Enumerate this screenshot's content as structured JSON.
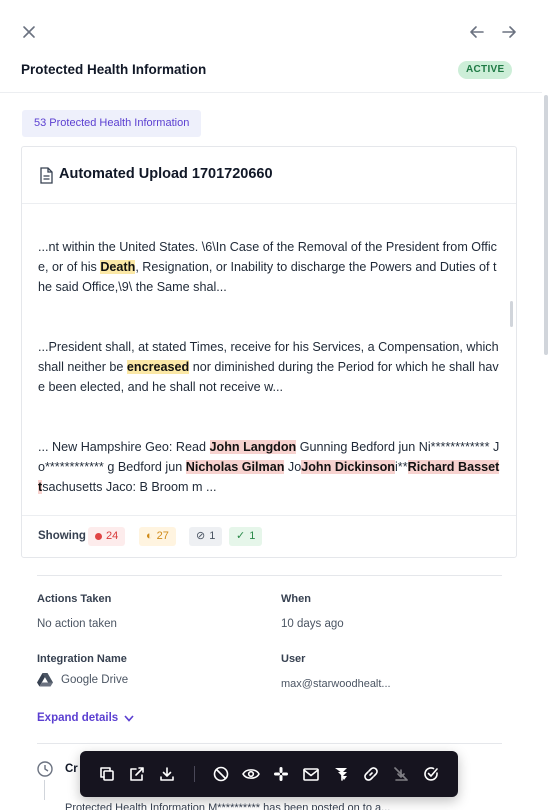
{
  "header": {
    "title": "Protected Health Information",
    "status": "ACTIVE"
  },
  "count_chip": "53 Protected Health Information",
  "document": {
    "title": "Automated Upload 1701720660",
    "snippets": [
      {
        "parts": [
          {
            "text": "...nt within the United States. \\6\\In Case of the Removal of the President from Office, or of his ",
            "hl": ""
          },
          {
            "text": "Death",
            "hl": "y"
          },
          {
            "text": ", Resignation, or Inability to discharge the Powers and Duties of the said Office,\\9\\ the Same shal...",
            "hl": ""
          }
        ]
      },
      {
        "parts": [
          {
            "text": "...President shall, at stated Times, receive for his Services, a Compensation, which shall neither be ",
            "hl": ""
          },
          {
            "text": "encreased",
            "hl": "y"
          },
          {
            "text": " nor diminished during the Period for which he shall have been elected, and he shall not receive w...",
            "hl": ""
          }
        ]
      },
      {
        "parts": [
          {
            "text": "... New Hampshire Geo: Read ",
            "hl": ""
          },
          {
            "text": "John Langdon",
            "hl": "r"
          },
          {
            "text": " Gunning Bedford jun Ni************ Jo************ g Bedford jun ",
            "hl": ""
          },
          {
            "text": "Nicholas Gilman",
            "hl": "r"
          },
          {
            "text": " Jo",
            "hl": ""
          },
          {
            "text": "John Dickinson",
            "hl": "r"
          },
          {
            "text": "i**",
            "hl": ""
          },
          {
            "text": "Richard Bassett",
            "hl": "r"
          },
          {
            "text": "sachusetts Jaco: B Broom m ...",
            "hl": ""
          }
        ]
      }
    ],
    "showing_label": "Showing",
    "counts": {
      "red": "24",
      "orange": "27",
      "gray": "1",
      "green": "1"
    }
  },
  "details": {
    "actions_taken_label": "Actions Taken",
    "actions_taken_value": "No action taken",
    "when_label": "When",
    "when_value": "10 days ago",
    "integration_label": "Integration Name",
    "integration_value": "Google Drive",
    "user_label": "User",
    "user_value": "max@starwoodhealt...",
    "expand_label": "Expand details"
  },
  "timeline": {
    "first": "Cr",
    "second": "Protected Health Information M********** has been posted on to a..."
  },
  "action_bar": {
    "icons": [
      "copy-icon",
      "external-link-icon",
      "download-icon",
      "block-icon",
      "eye-icon",
      "slack-icon",
      "mail-icon",
      "jira-icon",
      "link-icon",
      "unlink-icon",
      "check-circle-icon"
    ]
  },
  "colors": {
    "accent": "#5b3fd1",
    "active_badge_bg": "#cdeed8",
    "highlight_yellow": "#fbe8a6",
    "highlight_red": "#f7d2cf",
    "action_bar_bg": "#16141f"
  }
}
